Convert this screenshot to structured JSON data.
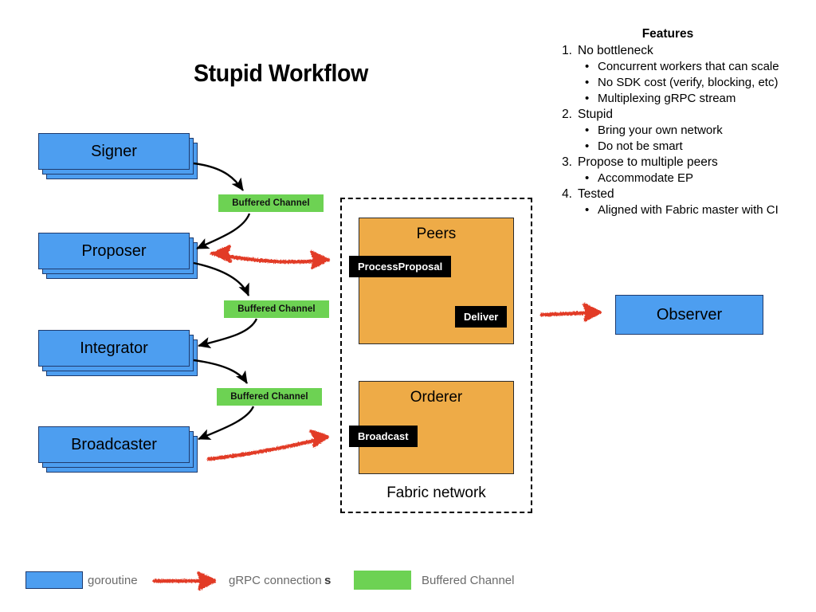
{
  "title": "Stupid Workflow",
  "goroutines": [
    {
      "label": "Signer"
    },
    {
      "label": "Proposer"
    },
    {
      "label": "Integrator"
    },
    {
      "label": "Broadcaster"
    }
  ],
  "observer": {
    "label": "Observer"
  },
  "channels": [
    {
      "label": "Buffered Channel"
    },
    {
      "label": "Buffered Channel"
    },
    {
      "label": "Buffered Channel"
    }
  ],
  "fabric": {
    "label": "Fabric network",
    "peers": {
      "title": "Peers",
      "process_proposal": "ProcessProposal",
      "deliver": "Deliver"
    },
    "orderer": {
      "title": "Orderer",
      "broadcast": "Broadcast"
    }
  },
  "features": {
    "heading": "Features",
    "items": [
      {
        "num": "1.",
        "text": "No bottleneck",
        "subs": [
          "Concurrent workers that can scale",
          "No SDK cost (verify, blocking, etc)",
          "Multiplexing gRPC stream"
        ]
      },
      {
        "num": "2.",
        "text": "Stupid",
        "subs": [
          "Bring your own network",
          "Do not be smart"
        ]
      },
      {
        "num": "3.",
        "text": " Propose to multiple peers",
        "subs": [
          " Accommodate EP"
        ]
      },
      {
        "num": "4.",
        "text": "Tested",
        "subs": [
          "Aligned with Fabric master with CI"
        ]
      }
    ],
    "bullet": "•"
  },
  "legend": {
    "goroutine_label": "goroutine",
    "grpc_label": "gRPC connection",
    "grpc_label_suffix": "s",
    "channel_label": "Buffered Channel"
  },
  "colors": {
    "goroutine_blue": "#4d9ef0",
    "goroutine_border": "#1f3b6e",
    "channel_green": "#6dd253",
    "fabric_orange": "#eeab47",
    "grpc_red": "#e23b26",
    "endpoint_black": "#000000"
  }
}
